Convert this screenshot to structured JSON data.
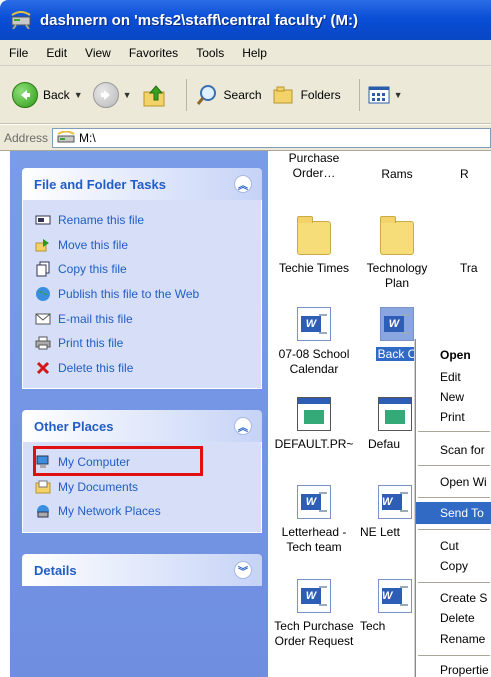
{
  "window": {
    "title": "dashnern on 'msfs2\\staff\\central faculty' (M:)"
  },
  "menubar": {
    "items": [
      "File",
      "Edit",
      "View",
      "Favorites",
      "Tools",
      "Help"
    ]
  },
  "toolbar": {
    "back_label": "Back",
    "search_label": "Search",
    "folders_label": "Folders"
  },
  "address": {
    "label": "Address",
    "value": "M:\\"
  },
  "tasks_panel": {
    "title": "File and Folder Tasks",
    "items": [
      {
        "label": "Rename this file",
        "icon": "rename-icon"
      },
      {
        "label": "Move this file",
        "icon": "move-icon"
      },
      {
        "label": "Copy this file",
        "icon": "copy-icon"
      },
      {
        "label": "Publish this file to the Web",
        "icon": "globe-icon"
      },
      {
        "label": "E-mail this file",
        "icon": "email-icon"
      },
      {
        "label": "Print this file",
        "icon": "printer-icon"
      },
      {
        "label": "Delete this file",
        "icon": "delete-icon"
      }
    ]
  },
  "places_panel": {
    "title": "Other Places",
    "items": [
      {
        "label": "My Computer",
        "icon": "computer-icon"
      },
      {
        "label": "My Documents",
        "icon": "documents-folder-icon"
      },
      {
        "label": "My Network Places",
        "icon": "network-icon"
      }
    ]
  },
  "details_panel": {
    "title": "Details"
  },
  "files": {
    "purchase_order": "Purchase Order…",
    "rams": "Rams",
    "r_partial": "R",
    "techie_times": "Techie Times",
    "technology_plan": "Technology Plan",
    "tra_partial": "Tra",
    "calendar": "07-08 School Calendar",
    "back_selected": "Back C",
    "default_pr": "DEFAULT.PR~",
    "defau_partial": "Defau",
    "letterhead": "Letterhead - Tech team",
    "ne_lett": "NE Lett",
    "tech_purchase": "Tech Purchase Order Request",
    "tech_partial": "Tech "
  },
  "context_menu": {
    "items": [
      "Open",
      "Edit",
      "New",
      "Print",
      "Scan for",
      "Open Wi",
      "Send To",
      "Cut",
      "Copy",
      "Create S",
      "Delete",
      "Rename",
      "Propertie"
    ]
  },
  "colors": {
    "title_blue": "#0a4fd6",
    "panel_link": "#215dc6",
    "selection": "#316ac5",
    "highlight_border": "#e01010"
  }
}
